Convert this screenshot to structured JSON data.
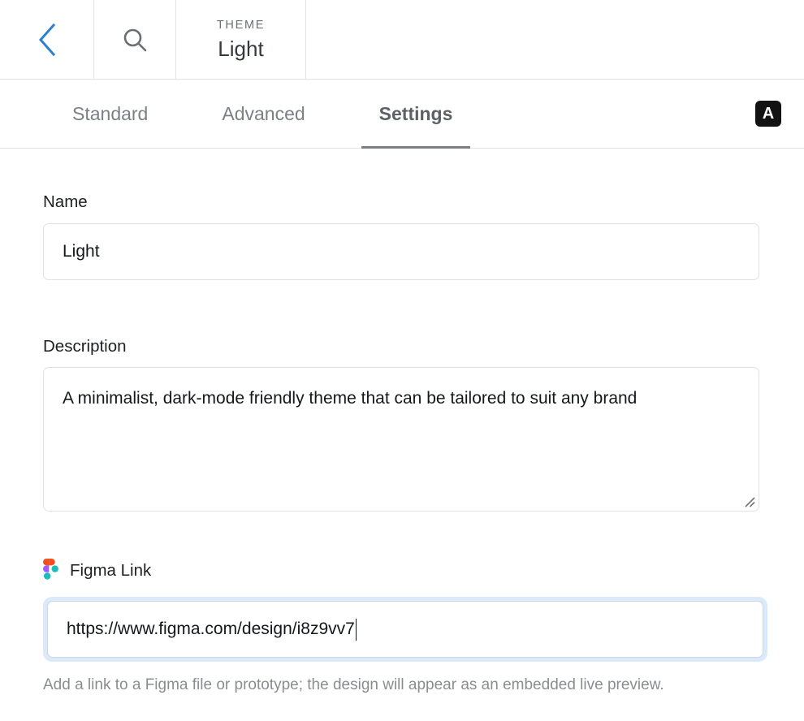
{
  "header": {
    "back_icon": "chevron-left-icon",
    "search_icon": "search-icon",
    "theme_eyebrow": "THEME",
    "theme_value": "Light",
    "accent_color": "#2f7fd1"
  },
  "tabs": {
    "items": [
      {
        "label": "Standard",
        "active": false
      },
      {
        "label": "Advanced",
        "active": false
      },
      {
        "label": "Settings",
        "active": true
      }
    ],
    "badge": {
      "label": "A",
      "background": "#121212",
      "color": "#ffffff"
    }
  },
  "form": {
    "name": {
      "label": "Name",
      "value": "Light",
      "placeholder": "Name"
    },
    "description": {
      "label": "Description",
      "value": "A minimalist, dark-mode friendly theme that can be tailored to suit any brand",
      "placeholder": "Description"
    },
    "figma": {
      "icon": "figma-logo-icon",
      "label": "Figma Link",
      "value": "https://www.figma.com/design/i8z9vv7",
      "placeholder": "https://",
      "focused": true,
      "focus_ring_color": "#dbeafb",
      "helper": "Add a link to a Figma file or prototype; the design will appear as an embedded live preview."
    }
  },
  "figma_colors": {
    "orange": "#f24e1e",
    "purple": "#a259ff",
    "teal": "#1abcbc",
    "blue": "#1abcfe",
    "green": "#0acf83"
  }
}
